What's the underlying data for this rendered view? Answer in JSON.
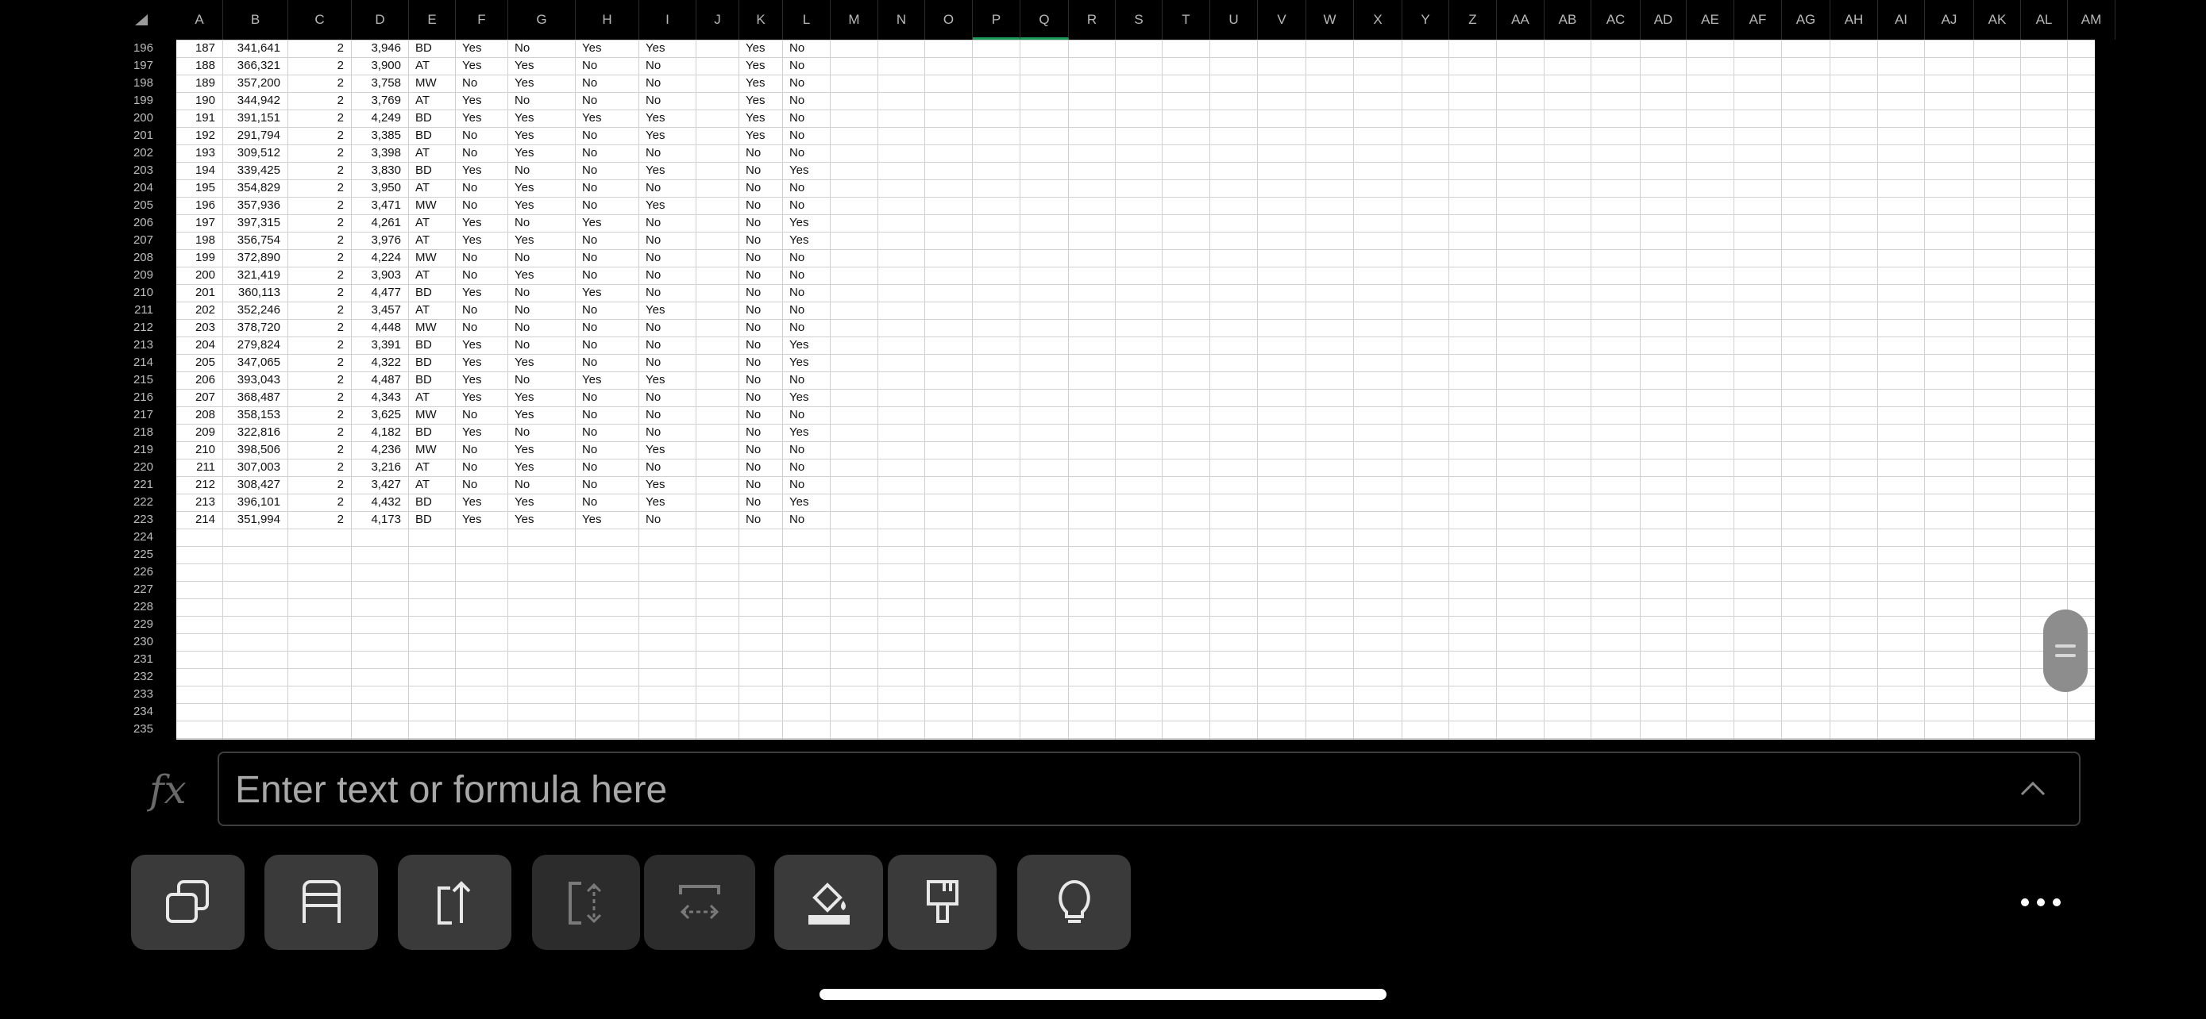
{
  "columns": [
    "A",
    "B",
    "C",
    "D",
    "E",
    "F",
    "G",
    "H",
    "I",
    "J",
    "K",
    "L",
    "M",
    "N",
    "O",
    "P",
    "Q",
    "R",
    "S",
    "T",
    "U",
    "V",
    "W",
    "X",
    "Y",
    "Z",
    "AA",
    "AB",
    "AC",
    "AD",
    "AE",
    "AF",
    "AG",
    "AH",
    "AI",
    "AJ",
    "AK",
    "AL",
    "AM"
  ],
  "selected_columns": [
    "P",
    "Q"
  ],
  "row_numbers": [
    "196",
    "197",
    "198",
    "199",
    "200",
    "201",
    "202",
    "203",
    "204",
    "205",
    "206",
    "207",
    "208",
    "209",
    "210",
    "211",
    "212",
    "213",
    "214",
    "215",
    "216",
    "217",
    "218",
    "219",
    "220",
    "221",
    "222",
    "223",
    "224",
    "225",
    "226",
    "227",
    "228",
    "229",
    "230",
    "231",
    "232",
    "233",
    "234",
    "235"
  ],
  "rows": [
    [
      "187",
      "341,641",
      "2",
      "3,946",
      "BD",
      "Yes",
      "No",
      "Yes",
      "Yes",
      "",
      "Yes",
      "No"
    ],
    [
      "188",
      "366,321",
      "2",
      "3,900",
      "AT",
      "Yes",
      "Yes",
      "No",
      "No",
      "",
      "Yes",
      "No"
    ],
    [
      "189",
      "357,200",
      "2",
      "3,758",
      "MW",
      "No",
      "Yes",
      "No",
      "No",
      "",
      "Yes",
      "No"
    ],
    [
      "190",
      "344,942",
      "2",
      "3,769",
      "AT",
      "Yes",
      "No",
      "No",
      "No",
      "",
      "Yes",
      "No"
    ],
    [
      "191",
      "391,151",
      "2",
      "4,249",
      "BD",
      "Yes",
      "Yes",
      "Yes",
      "Yes",
      "",
      "Yes",
      "No"
    ],
    [
      "192",
      "291,794",
      "2",
      "3,385",
      "BD",
      "No",
      "Yes",
      "No",
      "Yes",
      "",
      "Yes",
      "No"
    ],
    [
      "193",
      "309,512",
      "2",
      "3,398",
      "AT",
      "No",
      "Yes",
      "No",
      "No",
      "",
      "No",
      "No"
    ],
    [
      "194",
      "339,425",
      "2",
      "3,830",
      "BD",
      "Yes",
      "No",
      "No",
      "Yes",
      "",
      "No",
      "Yes"
    ],
    [
      "195",
      "354,829",
      "2",
      "3,950",
      "AT",
      "No",
      "Yes",
      "No",
      "No",
      "",
      "No",
      "No"
    ],
    [
      "196",
      "357,936",
      "2",
      "3,471",
      "MW",
      "No",
      "Yes",
      "No",
      "Yes",
      "",
      "No",
      "No"
    ],
    [
      "197",
      "397,315",
      "2",
      "4,261",
      "AT",
      "Yes",
      "No",
      "Yes",
      "No",
      "",
      "No",
      "Yes"
    ],
    [
      "198",
      "356,754",
      "2",
      "3,976",
      "AT",
      "Yes",
      "Yes",
      "No",
      "No",
      "",
      "No",
      "Yes"
    ],
    [
      "199",
      "372,890",
      "2",
      "4,224",
      "MW",
      "No",
      "No",
      "No",
      "No",
      "",
      "No",
      "No"
    ],
    [
      "200",
      "321,419",
      "2",
      "3,903",
      "AT",
      "No",
      "Yes",
      "No",
      "No",
      "",
      "No",
      "No"
    ],
    [
      "201",
      "360,113",
      "2",
      "4,477",
      "BD",
      "Yes",
      "No",
      "Yes",
      "No",
      "",
      "No",
      "No"
    ],
    [
      "202",
      "352,246",
      "2",
      "3,457",
      "AT",
      "No",
      "No",
      "No",
      "Yes",
      "",
      "No",
      "No"
    ],
    [
      "203",
      "378,720",
      "2",
      "4,448",
      "MW",
      "No",
      "No",
      "No",
      "No",
      "",
      "No",
      "No"
    ],
    [
      "204",
      "279,824",
      "2",
      "3,391",
      "BD",
      "Yes",
      "No",
      "No",
      "No",
      "",
      "No",
      "Yes"
    ],
    [
      "205",
      "347,065",
      "2",
      "4,322",
      "BD",
      "Yes",
      "Yes",
      "No",
      "No",
      "",
      "No",
      "Yes"
    ],
    [
      "206",
      "393,043",
      "2",
      "4,487",
      "BD",
      "Yes",
      "No",
      "Yes",
      "Yes",
      "",
      "No",
      "No"
    ],
    [
      "207",
      "368,487",
      "2",
      "4,343",
      "AT",
      "Yes",
      "Yes",
      "No",
      "No",
      "",
      "No",
      "Yes"
    ],
    [
      "208",
      "358,153",
      "2",
      "3,625",
      "MW",
      "No",
      "Yes",
      "No",
      "No",
      "",
      "No",
      "No"
    ],
    [
      "209",
      "322,816",
      "2",
      "4,182",
      "BD",
      "Yes",
      "No",
      "No",
      "No",
      "",
      "No",
      "Yes"
    ],
    [
      "210",
      "398,506",
      "2",
      "4,236",
      "MW",
      "No",
      "Yes",
      "No",
      "Yes",
      "",
      "No",
      "No"
    ],
    [
      "211",
      "307,003",
      "2",
      "3,216",
      "AT",
      "No",
      "Yes",
      "No",
      "No",
      "",
      "No",
      "No"
    ],
    [
      "212",
      "308,427",
      "2",
      "3,427",
      "AT",
      "No",
      "No",
      "No",
      "Yes",
      "",
      "No",
      "No"
    ],
    [
      "213",
      "396,101",
      "2",
      "4,432",
      "BD",
      "Yes",
      "Yes",
      "No",
      "Yes",
      "",
      "No",
      "Yes"
    ],
    [
      "214",
      "351,994",
      "2",
      "4,173",
      "BD",
      "Yes",
      "Yes",
      "Yes",
      "No",
      "",
      "No",
      "No"
    ]
  ],
  "formula_bar": {
    "icon": "fx-icon",
    "placeholder": "Enter text or formula here"
  },
  "toolbar": [
    {
      "name": "copy-button",
      "icon": "copy-icon"
    },
    {
      "name": "insert-row-button",
      "icon": "insert-row-icon"
    },
    {
      "name": "share-button",
      "icon": "share-icon"
    },
    {
      "name": "resize-row-button",
      "icon": "resize-row-icon"
    },
    {
      "name": "resize-column-button",
      "icon": "resize-column-icon"
    },
    {
      "name": "fill-color-button",
      "icon": "paint-bucket-icon"
    },
    {
      "name": "format-painter-button",
      "icon": "paintbrush-icon"
    },
    {
      "name": "ideas-button",
      "icon": "lightbulb-icon"
    }
  ],
  "colors": {
    "accent": "#1b9b5a",
    "background": "#000000",
    "grid": "#d0d0d0"
  }
}
